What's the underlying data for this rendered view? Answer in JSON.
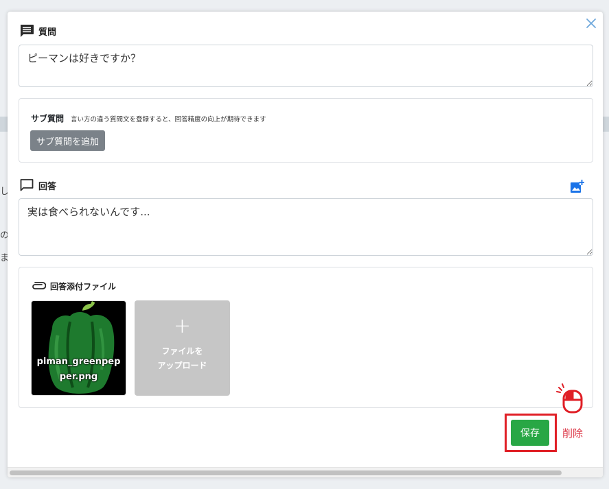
{
  "background": {
    "text_1": "し",
    "text_2": "の",
    "text_3": "ま"
  },
  "question": {
    "label": "質問",
    "value": "ピーマンは好きですか？"
  },
  "sub_question": {
    "title": "サブ質問",
    "hint": "言い方の違う質問文を登録すると、回答精度の向上が期待できます",
    "add_button": "サブ質問を追加"
  },
  "answer": {
    "label": "回答",
    "value": "実は食べられないんです..."
  },
  "attachments": {
    "title": "回答添付ファイル",
    "file_name": "piman_greenpepper.png",
    "upload_label_line1": "ファイルを",
    "upload_label_line2": "アップロード",
    "upload_plus": "+"
  },
  "actions": {
    "save": "保存",
    "delete": "削除"
  },
  "colors": {
    "accent_blue": "#1a73e8",
    "save_green": "#28a745",
    "delete_red": "#dc3545",
    "highlight_red": "#e01f26"
  }
}
